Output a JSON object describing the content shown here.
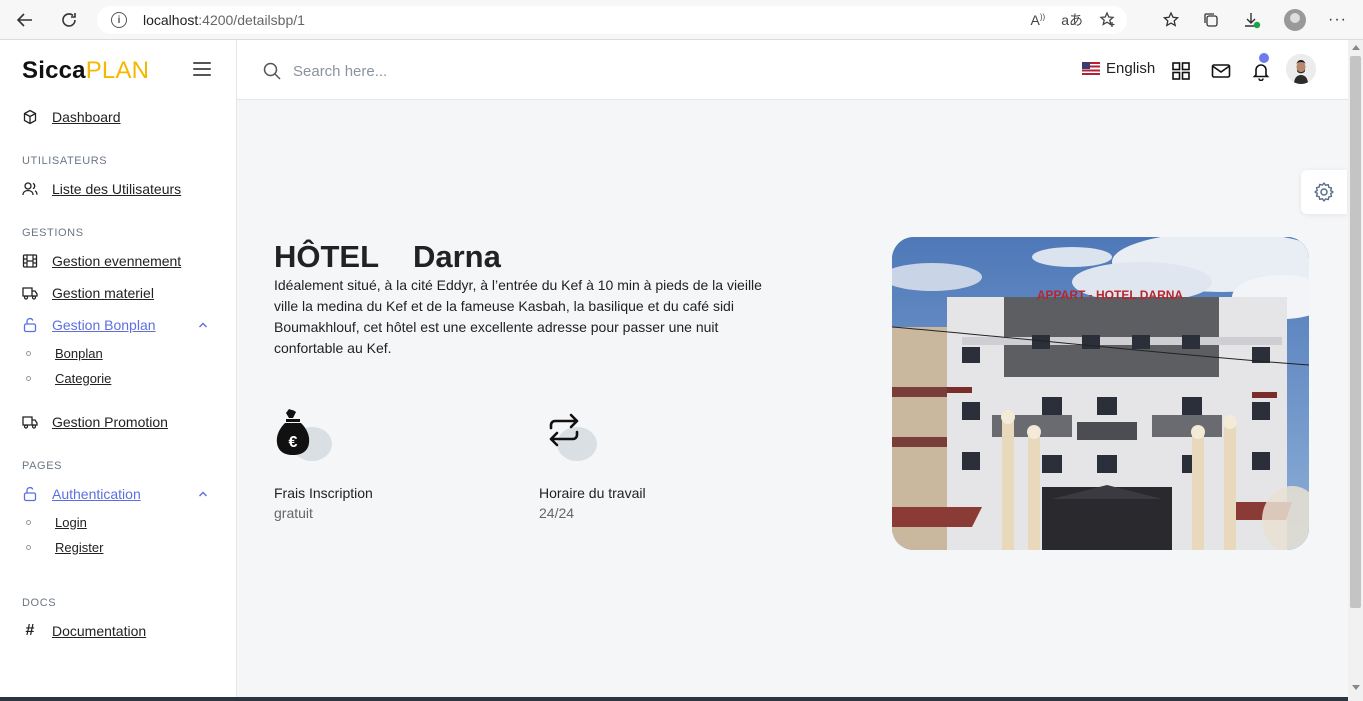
{
  "browser": {
    "url_host": "localhost",
    "url_path": ":4200/detailsbp/1"
  },
  "brand": {
    "part1": "Sicca",
    "part2": "PLAN"
  },
  "sidebar": {
    "dashboard": "Dashboard",
    "sections": {
      "users": "UTILISATEURS",
      "gestions": "GESTIONS",
      "pages": "PAGES",
      "docs": "DOCS"
    },
    "items": {
      "users_list": "Liste des Utilisateurs",
      "events": "Gestion evennement",
      "material": "Gestion materiel",
      "bonplan": "Gestion Bonplan",
      "bonplan_sub": [
        "Bonplan",
        "Categorie"
      ],
      "promotion": "Gestion Promotion",
      "auth": "Authentication",
      "auth_sub": [
        "Login",
        "Register"
      ],
      "documentation": "Documentation"
    },
    "accent_color": "#5d6fe0"
  },
  "topbar": {
    "search_placeholder": "Search here...",
    "language": "English"
  },
  "content": {
    "title": "HÔTEL    Darna",
    "description": "Idéalement situé, à la cité Eddyr, à l’entrée du Kef à 10 min à pieds de la vieille ville la medina du Kef et de la fameuse Kasbah, la basilique et du café sidi Boumakhlouf, cet hôtel est une excellente adresse pour passer une nuit confortable au Kef.",
    "features": [
      {
        "icon": "money-bag-icon",
        "label": "Frais Inscription",
        "value": "gratuit"
      },
      {
        "icon": "repeat-icon",
        "label": "Horaire du travail",
        "value": "24/24"
      }
    ],
    "photo_sign": "APPART - HOTEL DARNA"
  }
}
